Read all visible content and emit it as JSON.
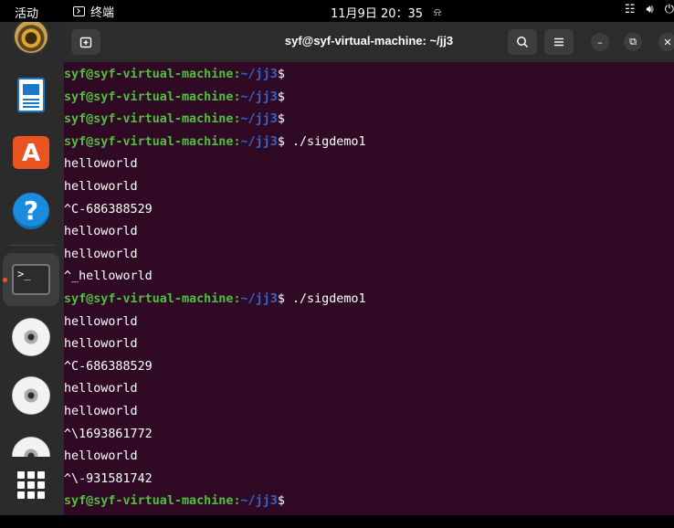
{
  "topbar": {
    "activities": "活动",
    "app_name": "终端",
    "clock": "11月9日  20：35",
    "tray_icons": [
      "network-icon",
      "volume-icon",
      "power-icon"
    ]
  },
  "dock": {
    "items": [
      "rhythmbox-icon",
      "writer-icon",
      "app-center-icon",
      "help-icon",
      "terminal-icon",
      "dvd-icon",
      "dvd-icon",
      "dvd-icon",
      "show-apps-icon"
    ]
  },
  "window": {
    "title": "syf@syf-virtual-machine: ~/jj3",
    "bg_color": "#300a24",
    "prompt_user_color": "#4fc03d",
    "prompt_path_color": "#3465c6"
  },
  "terminal": {
    "prompt_user": "syf@syf-virtual-machine",
    "prompt_colon": ":",
    "prompt_path": "~/jj3",
    "prompt_dollar": "$",
    "lines": [
      {
        "type": "prompt",
        "cmd": ""
      },
      {
        "type": "prompt",
        "cmd": ""
      },
      {
        "type": "prompt",
        "cmd": ""
      },
      {
        "type": "prompt",
        "cmd": " ./sigdemo1"
      },
      {
        "type": "out",
        "text": "helloworld"
      },
      {
        "type": "out",
        "text": "helloworld"
      },
      {
        "type": "out",
        "text": "^C-686388529"
      },
      {
        "type": "out",
        "text": "helloworld"
      },
      {
        "type": "out",
        "text": "helloworld"
      },
      {
        "type": "out",
        "text": "^_helloworld"
      },
      {
        "type": "prompt",
        "cmd": " ./sigdemo1"
      },
      {
        "type": "out",
        "text": "helloworld"
      },
      {
        "type": "out",
        "text": "helloworld"
      },
      {
        "type": "out",
        "text": "^C-686388529"
      },
      {
        "type": "out",
        "text": "helloworld"
      },
      {
        "type": "out",
        "text": "helloworld"
      },
      {
        "type": "out",
        "text": "^\\1693861772"
      },
      {
        "type": "out",
        "text": "helloworld"
      },
      {
        "type": "out",
        "text": "^\\-931581742"
      },
      {
        "type": "prompt",
        "cmd": ""
      }
    ]
  }
}
